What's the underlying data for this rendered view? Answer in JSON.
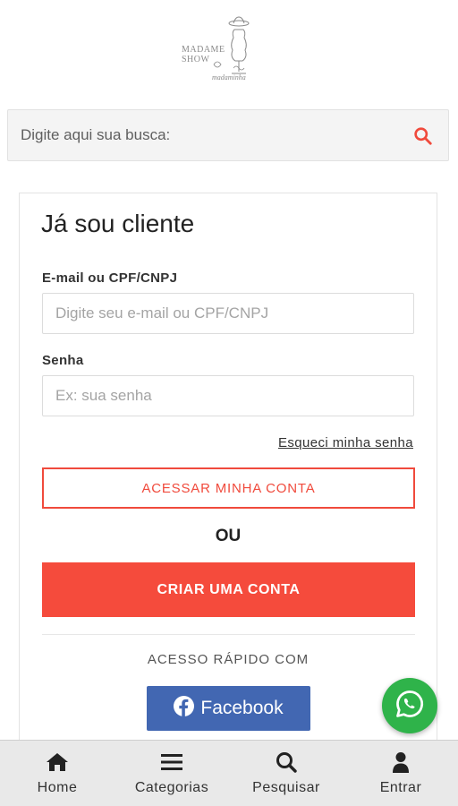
{
  "header": {
    "logo": {
      "line1": "MADAME",
      "line2": "SHOW",
      "script": "madaminha"
    }
  },
  "search": {
    "placeholder": "Digite aqui sua busca:",
    "icon": "search-icon",
    "icon_color": "#f04a3c"
  },
  "login": {
    "title": "Já sou cliente",
    "email_label": "E-mail ou CPF/CNPJ",
    "email_placeholder": "Digite seu e-mail ou CPF/CNPJ",
    "password_label": "Senha",
    "password_placeholder": "Ex: sua senha",
    "forgot_link": "Esqueci minha senha",
    "access_button": "ACESSAR MINHA CONTA",
    "or_text": "OU",
    "create_button": "CRIAR UMA CONTA",
    "quick_access": "ACESSO RÁPIDO COM",
    "facebook_button": "Facebook"
  },
  "colors": {
    "accent": "#f04a3c",
    "facebook": "#4267b2",
    "whatsapp": "#2fb34a"
  },
  "fab": {
    "icon": "whatsapp-icon"
  },
  "bottom_nav": {
    "items": [
      {
        "label": "Home",
        "icon": "home-icon"
      },
      {
        "label": "Categorias",
        "icon": "menu-icon"
      },
      {
        "label": "Pesquisar",
        "icon": "search-icon"
      },
      {
        "label": "Entrar",
        "icon": "user-icon"
      }
    ]
  }
}
